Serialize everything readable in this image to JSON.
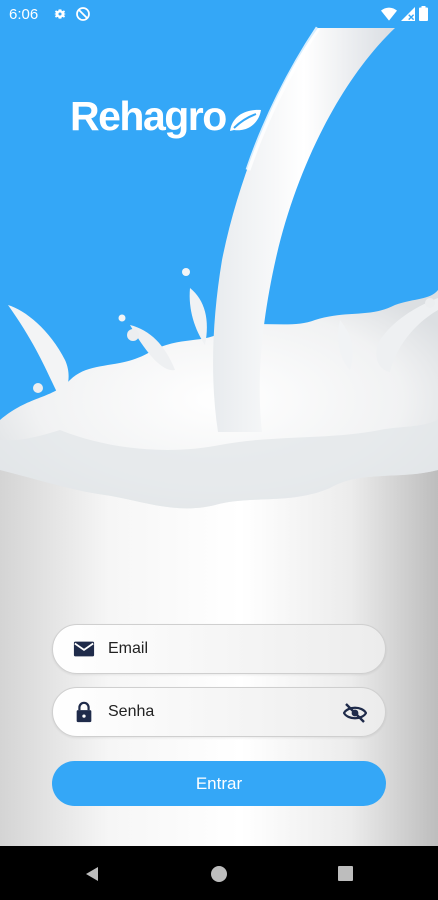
{
  "status_bar": {
    "time": "6:06",
    "icons": [
      "gear-icon",
      "dnd-icon",
      "wifi-icon",
      "signal-icon",
      "battery-icon"
    ]
  },
  "app": {
    "brand": "Rehagro",
    "logo_icon": "leaf-icon"
  },
  "login": {
    "email_placeholder": "Email",
    "email_icon": "mail-icon",
    "password_placeholder": "Senha",
    "password_icon": "lock-icon",
    "visibility_icon": "eye-off-icon",
    "submit_label": "Entrar"
  },
  "nav_bar": {
    "icons": [
      "back-icon",
      "home-icon",
      "recents-icon"
    ]
  },
  "colors": {
    "background_blue": "#34a7f7",
    "button_blue": "#34a7f7",
    "icon_dark": "#1f2b4a"
  }
}
